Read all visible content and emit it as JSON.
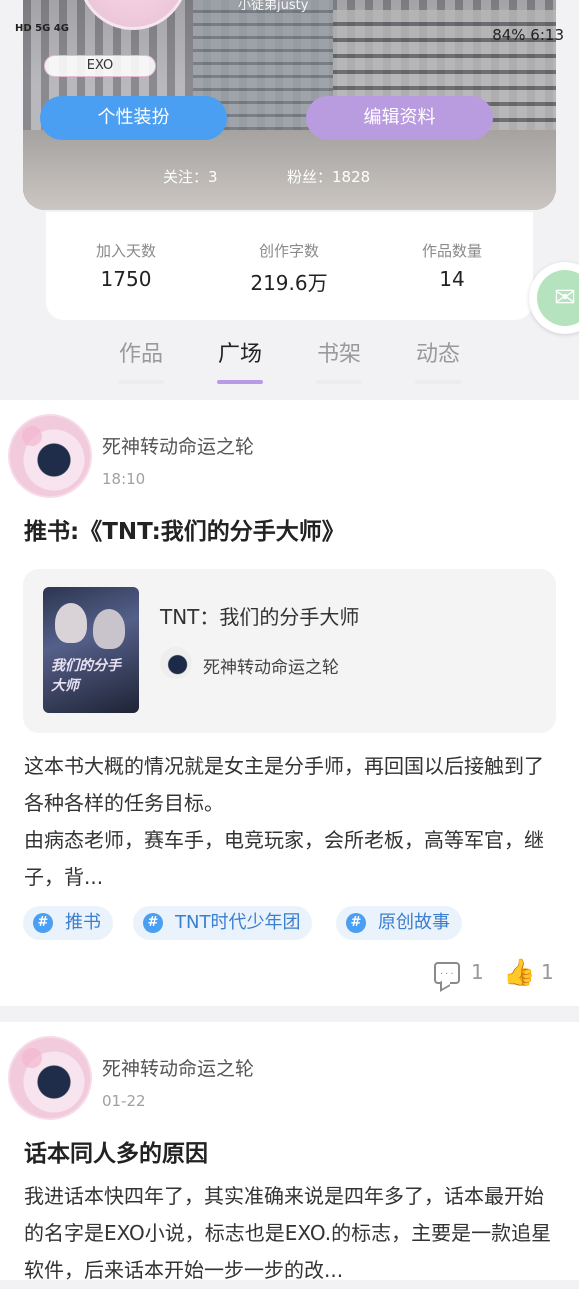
{
  "status_bar": {
    "left_indicators": "HD 5G 4G",
    "right": "84%  6:13"
  },
  "profile": {
    "username": "小徒弟justy",
    "tag": "EXO",
    "dress_button": "个性装扮",
    "edit_button": "编辑资料",
    "following": "关注：3",
    "fans": "粉丝：1828"
  },
  "stats": [
    {
      "label": "加入天数",
      "value": "1750"
    },
    {
      "label": "创作字数",
      "value": "219.6万"
    },
    {
      "label": "作品数量",
      "value": "14"
    }
  ],
  "tabs": [
    {
      "label": "作品",
      "active": false
    },
    {
      "label": "广场",
      "active": true
    },
    {
      "label": "书架",
      "active": false
    },
    {
      "label": "动态",
      "active": false
    }
  ],
  "posts": [
    {
      "author": "死神转动命运之轮",
      "time": "18:10",
      "title": "推书:《TNT:我们的分手大师》",
      "book": {
        "title": "TNT：我们的分手大师",
        "author": "死神转动命运之轮",
        "cover_text": "我们的分手大师"
      },
      "body": "这本书大概的情况就是女主是分手师，再回国以后接触到了各种各样的任务目标。\n由病态老师，赛车手，电竞玩家，会所老板，高等军官，继子，背...",
      "tags": [
        "推书",
        "TNT时代少年团",
        "原创故事"
      ],
      "comments": "1",
      "likes": "1"
    },
    {
      "author": "死神转动命运之轮",
      "time": "01-22",
      "title": "话本同人多的原因",
      "body": "我进话本快四年了，其实准确来说是四年多了，话本最开始的名字是EXO小说，标志也是EXO.的标志，主要是一款追星软件，后来话本开始一步一步的改..."
    }
  ]
}
